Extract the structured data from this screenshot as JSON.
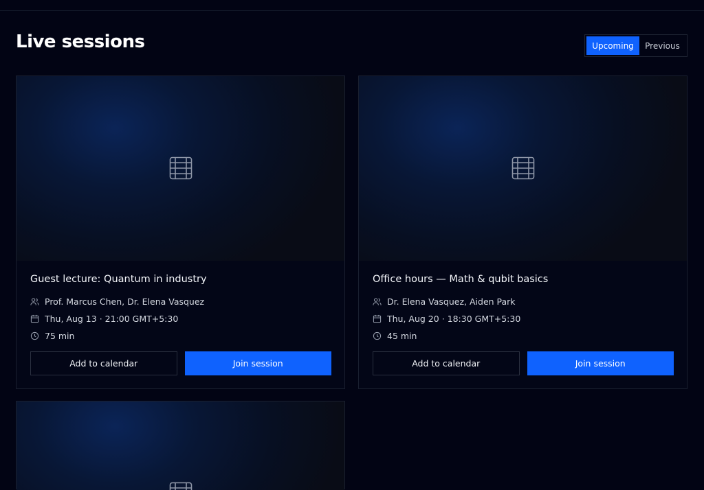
{
  "header": {
    "title": "Live sessions"
  },
  "filter": {
    "upcoming": "Upcoming",
    "previous": "Previous"
  },
  "sessions": [
    {
      "title": "Guest lecture: Quantum in industry",
      "hosts": "Prof. Marcus Chen, Dr. Elena Vasquez",
      "datetime": "Thu, Aug 13 · 21:00 GMT+5:30",
      "duration": "75 min",
      "add_label": "Add to calendar",
      "join_label": "Join session"
    },
    {
      "title": "Office hours — Math & qubit basics",
      "hosts": "Dr. Elena Vasquez, Aiden Park",
      "datetime": "Thu, Aug 20 · 18:30 GMT+5:30",
      "duration": "45 min",
      "add_label": "Add to calendar",
      "join_label": "Join session"
    }
  ],
  "colors": {
    "accent": "#0f62fe",
    "background": "#020414"
  },
  "icons": {
    "thumbnail": "film-icon",
    "hosts": "users-icon",
    "date": "calendar-icon",
    "duration": "clock-icon"
  }
}
